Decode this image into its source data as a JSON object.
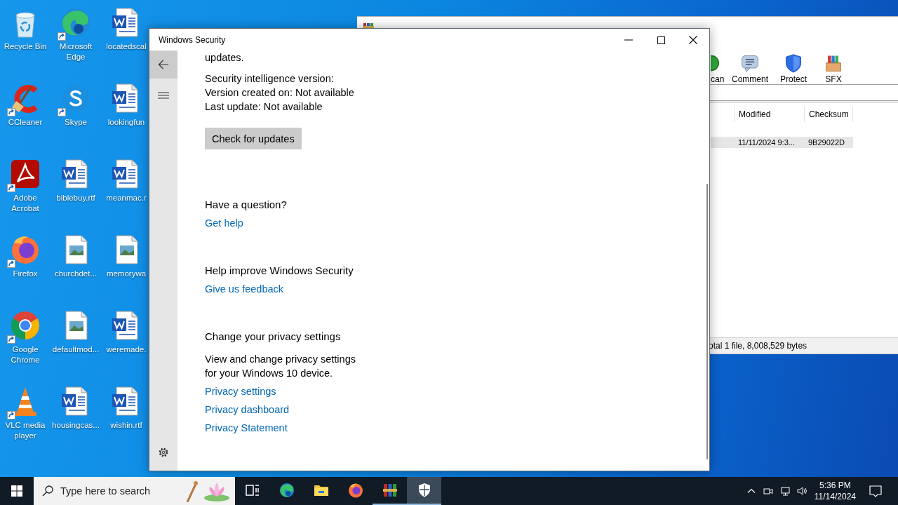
{
  "desktop_icons": [
    {
      "label": "Recycle Bin",
      "kind": "recycle",
      "shortcut": false
    },
    {
      "label": "Microsoft Edge",
      "kind": "edge",
      "shortcut": true
    },
    {
      "label": "locatedscal",
      "kind": "word",
      "shortcut": false
    },
    {
      "label": "CCleaner",
      "kind": "ccleaner",
      "shortcut": true
    },
    {
      "label": "Skype",
      "kind": "skype",
      "shortcut": true
    },
    {
      "label": "lookingfun",
      "kind": "word",
      "shortcut": false
    },
    {
      "label": "Adobe Acrobat",
      "kind": "acrobat",
      "shortcut": true
    },
    {
      "label": "biblebuy.rtf",
      "kind": "word",
      "shortcut": false
    },
    {
      "label": "meanmac.r",
      "kind": "word",
      "shortcut": false
    },
    {
      "label": "Firefox",
      "kind": "firefox",
      "shortcut": true
    },
    {
      "label": "churchdet...",
      "kind": "image",
      "shortcut": false
    },
    {
      "label": "memorywa",
      "kind": "image",
      "shortcut": false
    },
    {
      "label": "Google Chrome",
      "kind": "chrome",
      "shortcut": true
    },
    {
      "label": "defaultmod...",
      "kind": "image",
      "shortcut": false
    },
    {
      "label": "weremade.",
      "kind": "word",
      "shortcut": false
    },
    {
      "label": "VLC media player",
      "kind": "vlc",
      "shortcut": true
    },
    {
      "label": "housingcas...",
      "kind": "word",
      "shortcut": false
    },
    {
      "label": "wishin.rtf",
      "kind": "word",
      "shortcut": false
    }
  ],
  "archive_window": {
    "toolbar": [
      {
        "kind": "scan",
        "label": "can"
      },
      {
        "kind": "comment",
        "label": "Comment"
      },
      {
        "kind": "protect",
        "label": "Protect"
      },
      {
        "kind": "sfx",
        "label": "SFX"
      }
    ],
    "columns": [
      "Modified",
      "Checksum"
    ],
    "rows": [
      {
        "cells": [
          "11/11/2024 9:3...",
          "9B29022D"
        ],
        "selected": true
      }
    ],
    "status_bar": "otal 1 file, 8,008,529 bytes"
  },
  "security_window": {
    "title": "Windows Security",
    "content": [
      {
        "kind": "text",
        "text": "updates."
      },
      {
        "kind": "info",
        "lines": [
          "Security intelligence version:",
          "Version created on: Not available",
          "Last update: Not available"
        ]
      },
      {
        "kind": "button",
        "label": "Check for updates"
      },
      {
        "kind": "section",
        "heading": "Have a question?",
        "links": [
          "Get help"
        ]
      },
      {
        "kind": "section",
        "heading": "Help improve Windows Security",
        "links": [
          "Give us feedback"
        ]
      },
      {
        "kind": "section",
        "heading": "Change your privacy settings",
        "body": "View and change privacy settings for your Windows 10 device.",
        "links": [
          "Privacy settings",
          "Privacy dashboard",
          "Privacy Statement"
        ]
      }
    ]
  },
  "taskbar": {
    "search": {
      "placeholder": "Type here to search"
    },
    "apps": [
      {
        "kind": "task-view",
        "running": false,
        "selected": false
      },
      {
        "kind": "edge",
        "running": false,
        "selected": false
      },
      {
        "kind": "explorer",
        "running": false,
        "selected": false
      },
      {
        "kind": "firefox",
        "running": false,
        "selected": false
      },
      {
        "kind": "winrar",
        "running": true,
        "selected": false
      },
      {
        "kind": "security",
        "running": true,
        "selected": true
      }
    ],
    "clock": {
      "time": "5:36 PM",
      "date": "11/14/2024"
    }
  }
}
